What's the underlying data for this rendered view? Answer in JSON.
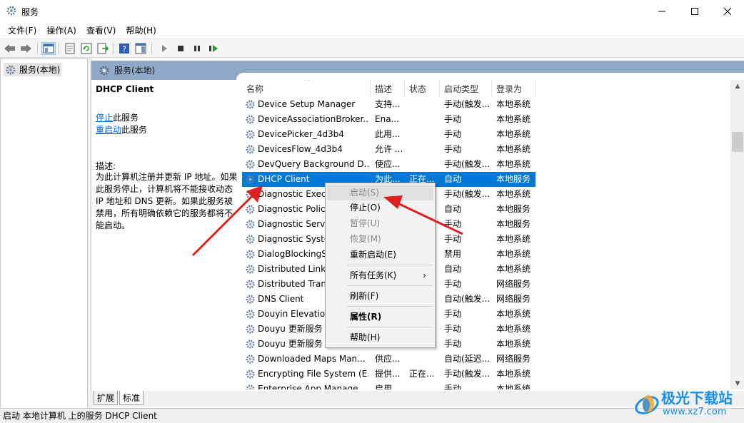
{
  "window": {
    "title": "服务"
  },
  "menu": [
    "文件(F)",
    "操作(A)",
    "查看(V)",
    "帮助(H)"
  ],
  "toolbar_icons": [
    "back-icon",
    "forward-icon",
    "console-tree-icon",
    "properties-icon",
    "refresh-icon",
    "export-icon",
    "help-icon",
    "show-hide-icon",
    "start-service-icon",
    "stop-service-icon",
    "pause-service-icon",
    "restart-service-icon"
  ],
  "tree": {
    "item": "服务(本地)"
  },
  "pane": {
    "header": "服务(本地)"
  },
  "detail": {
    "service_name": "DHCP Client",
    "stop_link": "停止",
    "stop_suffix": "此服务",
    "restart_link": "重启动",
    "restart_suffix": "此服务",
    "desc_label": "描述:",
    "desc_text": "为此计算机注册并更新 IP 地址。如果此服务停止，计算机将不能接收动态 IP 地址和 DNS 更新。如果此服务被禁用，所有明确依赖它的服务都将不能启动。"
  },
  "columns": [
    "名称",
    "描述",
    "状态",
    "启动类型",
    "登录为"
  ],
  "rows": [
    {
      "name": "Device Setup Manager",
      "desc": "支持...",
      "status": "",
      "startup": "手动(触发...",
      "logon": "本地系统"
    },
    {
      "name": "DeviceAssociationBroker...",
      "desc": "Ena...",
      "status": "",
      "startup": "手动",
      "logon": "本地系统"
    },
    {
      "name": "DevicePicker_4d3b4",
      "desc": "此用...",
      "status": "",
      "startup": "手动",
      "logon": "本地系统"
    },
    {
      "name": "DevicesFlow_4d3b4",
      "desc": "允许 ...",
      "status": "",
      "startup": "手动",
      "logon": "本地系统"
    },
    {
      "name": "DevQuery Background D...",
      "desc": "使应...",
      "status": "",
      "startup": "手动(触发...",
      "logon": "本地系统"
    },
    {
      "name": "DHCP Client",
      "desc": "为此...",
      "status": "正在...",
      "startup": "自动",
      "logon": "本地服务"
    },
    {
      "name": "Diagnostic Execu",
      "desc": "",
      "status": "",
      "startup": "手动(触发...",
      "logon": "本地系统"
    },
    {
      "name": "Diagnostic Policy",
      "desc": "",
      "status": "",
      "startup": "自动",
      "logon": "本地服务"
    },
    {
      "name": "Diagnostic Servi",
      "desc": "",
      "status": "",
      "startup": "手动",
      "logon": "本地服务"
    },
    {
      "name": "Diagnostic Syste",
      "desc": "",
      "status": "",
      "startup": "手动",
      "logon": "本地系统"
    },
    {
      "name": "DialogBlockingS",
      "desc": "",
      "status": "",
      "startup": "禁用",
      "logon": "本地系统"
    },
    {
      "name": "Distributed Link",
      "desc": "",
      "status": "",
      "startup": "自动",
      "logon": "本地系统"
    },
    {
      "name": "Distributed Tran",
      "desc": "",
      "status": "",
      "startup": "手动",
      "logon": "网络服务"
    },
    {
      "name": "DNS Client",
      "desc": "",
      "status": "",
      "startup": "自动(触发...",
      "logon": "网络服务"
    },
    {
      "name": "Douyin Elevation",
      "desc": "",
      "status": "",
      "startup": "手动",
      "logon": "本地系统"
    },
    {
      "name": "Douyu 更新服务",
      "desc": "",
      "status": "",
      "startup": "手动",
      "logon": "本地系统"
    },
    {
      "name": "Douyu 更新服务",
      "desc": "",
      "status": "",
      "startup": "手动",
      "logon": "本地系统"
    },
    {
      "name": "Downloaded Maps Man...",
      "desc": "供应...",
      "status": "",
      "startup": "自动(延迟...",
      "logon": "网络服务"
    },
    {
      "name": "Encrypting File System (E...",
      "desc": "提供...",
      "status": "正在...",
      "startup": "手动(触发...",
      "logon": "本地系统"
    },
    {
      "name": "Enterprise App Manage...",
      "desc": "启用...",
      "status": "",
      "startup": "手动",
      "logon": "本地系统"
    }
  ],
  "context_menu": {
    "start": "启动(S)",
    "stop": "停止(O)",
    "pause": "暂停(U)",
    "resume": "恢复(M)",
    "restart": "重新启动(E)",
    "all_tasks": "所有任务(K)",
    "refresh": "刷新(F)",
    "properties": "属性(R)",
    "help": "帮助(H)"
  },
  "tabs": [
    "扩展",
    "标准"
  ],
  "status": "启动 本地计算机 上的服务 DHCP Client",
  "watermark": {
    "name": "极光下载站",
    "url": "www.xz7.com"
  },
  "colors": {
    "selection": "#0078d7",
    "header_bar": "#8fa8c8",
    "link": "#0066cc",
    "annotation_arrow": "#e02020"
  }
}
